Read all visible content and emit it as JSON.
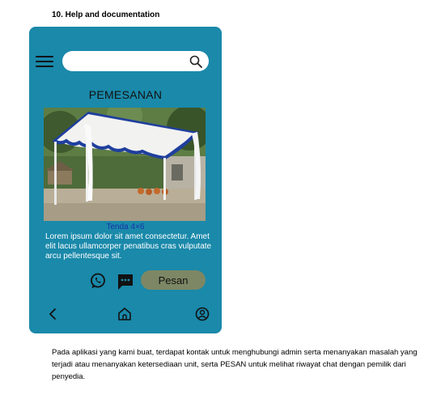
{
  "section_heading": "10. Help and documentation",
  "app": {
    "search": {
      "value": "",
      "placeholder": ""
    },
    "page_title": "PEMESANAN",
    "product": {
      "caption": "Tenda 4×6",
      "description": "Lorem ipsum dolor sit amet consectetur. Amet elit lacus ullamcorper penatibus cras vulputate arcu pellentesque sit."
    },
    "actions": {
      "order_label": "Pesan"
    },
    "icons": [
      "menu-icon",
      "search-icon",
      "whatsapp-icon",
      "chat-icon",
      "back-icon",
      "home-icon",
      "profile-icon"
    ],
    "colors": {
      "phone_bg": "#1a89aa",
      "order_button": "#7d8765",
      "caption": "#1a33a8"
    }
  },
  "paragraph": "Pada aplikasi yang kami buat, terdapat kontak untuk menghubungi admin serta menanyakan masalah yang terjadi atau menanyakan ketersediaan unit, serta PESAN untuk melihat riwayat chat dengan pemilik dari penyedia."
}
